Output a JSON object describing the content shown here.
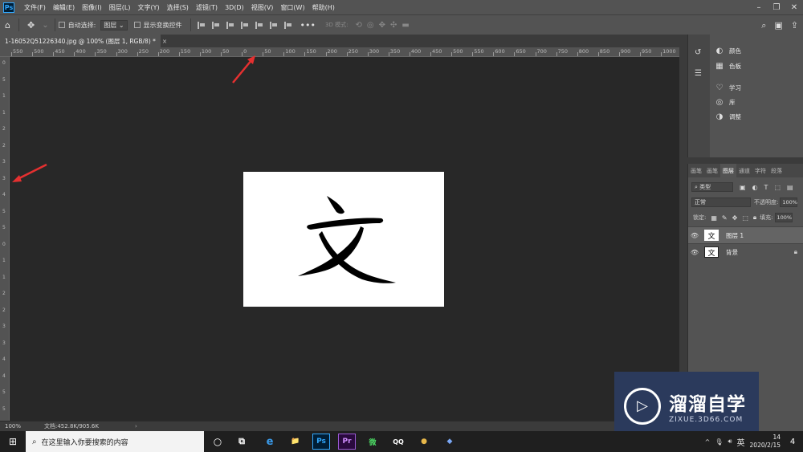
{
  "app": {
    "logo": "Ps"
  },
  "menu": [
    "文件(F)",
    "编辑(E)",
    "图像(I)",
    "图层(L)",
    "文字(Y)",
    "选择(S)",
    "滤镜(T)",
    "3D(D)",
    "视图(V)",
    "窗口(W)",
    "帮助(H)"
  ],
  "options": {
    "auto_select_label": "自动选择:",
    "auto_select_value": "图层",
    "show_transform_label": "显示变换控件",
    "mode_3d_label": "3D 模式:"
  },
  "document": {
    "tab_title": "1-16052Q51226340.jpg @ 100% (图层 1, RGB/8) *",
    "tab_close": "×",
    "content_glyph": "文"
  },
  "ruler": {
    "top_labels": [
      "550",
      "500",
      "450",
      "400",
      "350",
      "300",
      "250",
      "200",
      "150",
      "100",
      "50",
      "0",
      "50",
      "100",
      "150",
      "200",
      "250",
      "300",
      "350",
      "400",
      "450",
      "500",
      "550",
      "600",
      "650",
      "700",
      "750",
      "800",
      "850",
      "900",
      "950",
      "1000"
    ],
    "left_labels": [
      "0",
      "5",
      "1",
      "1",
      "2",
      "2",
      "3",
      "3",
      "4",
      "5",
      "5",
      "0",
      "1",
      "1",
      "2",
      "2",
      "3",
      "3",
      "4",
      "4",
      "5",
      "5"
    ]
  },
  "status": {
    "zoom": "100%",
    "doc_info": "文档:452.8K/905.6K",
    "arrow": "›"
  },
  "panels_top": [
    {
      "icon": "palette-icon",
      "glyph": "◐",
      "label": "颜色"
    },
    {
      "icon": "swatches-icon",
      "glyph": "▦",
      "label": "色板"
    },
    {
      "icon": "learn-icon",
      "glyph": "♡",
      "label": "学习"
    },
    {
      "icon": "libraries-icon",
      "glyph": "◎",
      "label": "库"
    },
    {
      "icon": "adjustments-icon",
      "glyph": "◑",
      "label": "调整"
    }
  ],
  "layers_panel": {
    "tabs": [
      "画笔",
      "画笔",
      "图层",
      "通道",
      "字符",
      "段落"
    ],
    "active_tab": "图层",
    "filter_label": "类型",
    "blend_mode": "正常",
    "opacity_label": "不透明度:",
    "opacity_value": "100%",
    "lock_label": "锁定:",
    "fill_label": "填充:",
    "fill_value": "100%",
    "layers": [
      {
        "name": "图层 1",
        "thumb": "文",
        "selected": true,
        "locked": false
      },
      {
        "name": "背景",
        "thumb": "文",
        "selected": false,
        "locked": true
      }
    ]
  },
  "watermark": {
    "title": "溜溜自学",
    "subtitle": "ZIXUE.3D66.COM"
  },
  "taskbar": {
    "search_placeholder": "在这里输入你要搜索的内容",
    "apps": [
      "e",
      "📁",
      "Ps",
      "Pr",
      "微",
      "QQ",
      "●",
      "◆"
    ],
    "ime": "英",
    "time": "14",
    "date": "2020/2/15",
    "notifications": "4"
  },
  "colors": {
    "accent": "#31a8ff",
    "arrow": "#e53030",
    "panel": "#535353",
    "canvas_bg": "#282828"
  }
}
